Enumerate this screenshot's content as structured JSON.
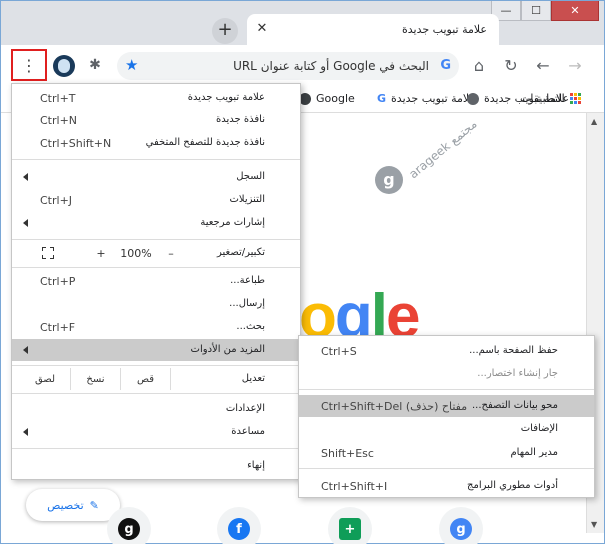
{
  "window": {
    "controls": {
      "minimize": "—",
      "maximize": "☐",
      "close": "✕"
    }
  },
  "tab": {
    "title": "علامة تبويب جديدة",
    "close_glyph": "✕",
    "newtab_glyph": "+"
  },
  "toolbar": {
    "menu_glyph": "⋮",
    "extensions_glyph": "✱",
    "bookmark_star_glyph": "★",
    "omnibox_placeholder": "البحث في Google أو كتابة عنوان URL",
    "omnibox_engine_glyph": "G",
    "home_glyph": "⌂",
    "reload_glyph": "↻",
    "back_glyph": "←",
    "forward_glyph": "→"
  },
  "bookmarks": {
    "apps": "التطبيقات",
    "items": [
      {
        "label": "علامة تبويب جديدة",
        "icon": "globe-icon"
      },
      {
        "label": "علامة تبويب جديدة",
        "icon": "google-g-icon"
      },
      {
        "label": "Google",
        "icon": "google-g-icon"
      }
    ],
    "apps_colors": [
      "#ea4335",
      "#fbbc05",
      "#34a853",
      "#4285f4",
      "#ea4335",
      "#fbbc05",
      "#34a853",
      "#4285f4",
      "#ea4335"
    ]
  },
  "content": {
    "watermark_text": "arageek مجتمع",
    "watermark_glyph": "g",
    "logo_partial": "ogle",
    "customize_label": "تخصيص",
    "customize_icon": "pencil-icon"
  },
  "menu": {
    "items": [
      {
        "label": "علامة تبويب جديدة",
        "shortcut": "Ctrl+T"
      },
      {
        "label": "نافذة جديدة",
        "shortcut": "Ctrl+N"
      },
      {
        "label": "نافذة جديدة للتصفح المتخفي",
        "shortcut": "Ctrl+Shift+N"
      },
      {
        "label": "السجل",
        "shortcut": ""
      },
      {
        "label": "التنزيلات",
        "shortcut": "Ctrl+J"
      },
      {
        "label": "إشارات مرجعية",
        "shortcut": ""
      },
      {
        "label": "تكبير/تصغير",
        "shortcut": ""
      },
      {
        "label": "طباعة...",
        "shortcut": "Ctrl+P"
      },
      {
        "label": "إرسال...",
        "shortcut": ""
      },
      {
        "label": "بحث...",
        "shortcut": "Ctrl+F"
      },
      {
        "label": "المزيد من الأدوات",
        "shortcut": ""
      },
      {
        "label": "تعديل",
        "shortcut": ""
      },
      {
        "label": "الإعدادات",
        "shortcut": ""
      },
      {
        "label": "مساعدة",
        "shortcut": ""
      },
      {
        "label": "إنهاء",
        "shortcut": ""
      }
    ],
    "zoom": {
      "minus": "–",
      "value": "100%",
      "plus": "+"
    },
    "edit": {
      "cut": "قص",
      "copy": "نسخ",
      "paste": "لصق"
    }
  },
  "submenu": {
    "items": [
      {
        "label": "حفظ الصفحة باسم...",
        "shortcut": "Ctrl+S"
      },
      {
        "label": "جار إنشاء اختصار...",
        "shortcut": ""
      },
      {
        "label": "محو بيانات التصفح...",
        "shortcut": "Ctrl+Shift+Del مفتاح (حذف)"
      },
      {
        "label": "الإضافات",
        "shortcut": ""
      },
      {
        "label": "مدير المهام",
        "shortcut": "Shift+Esc"
      },
      {
        "label": "أدوات مطوري البرامج",
        "shortcut": "Ctrl+Shift+I"
      }
    ]
  },
  "colors": {
    "accent": "#1a73e8",
    "highlight_border": "#e01f1f",
    "google_blue": "#4285f4",
    "google_red": "#ea4335",
    "google_yellow": "#fbbc05",
    "google_green": "#34a853"
  }
}
